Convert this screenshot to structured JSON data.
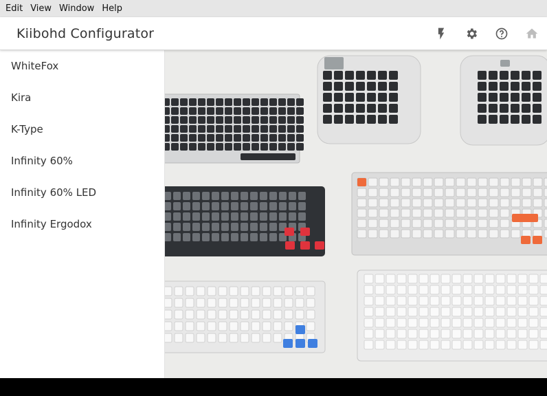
{
  "menu": {
    "items": [
      "Edit",
      "View",
      "Window",
      "Help"
    ]
  },
  "app": {
    "title": "Kiibohd Configurator"
  },
  "toolbar": {
    "icons": [
      "flash-icon",
      "settings-gear-icon",
      "help-circle-icon",
      "home-icon"
    ]
  },
  "sidebar": {
    "items": [
      {
        "label": "WhiteFox"
      },
      {
        "label": "Kira"
      },
      {
        "label": "K-Type"
      },
      {
        "label": "Infinity 60%"
      },
      {
        "label": "Infinity 60% LED"
      },
      {
        "label": "Infinity Ergodox"
      }
    ]
  },
  "hero": {
    "description_icon": "keyboards-photo"
  },
  "colors": {
    "appbar_bg": "#ffffff",
    "menubar_bg": "#e6e6e6",
    "accent_orange": "#ef6a3a",
    "accent_red": "#e0333d",
    "accent_blue": "#3f7fe0",
    "dark_case": "#2f3236"
  }
}
